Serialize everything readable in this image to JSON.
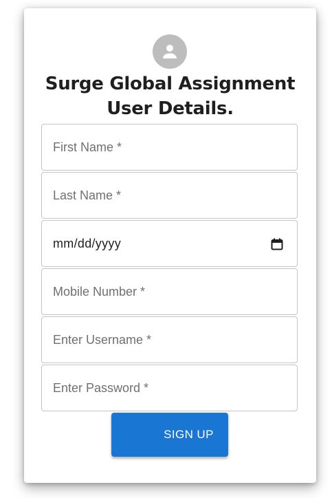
{
  "header": {
    "avatar_icon": "person-icon",
    "title_line1": "Surge Global Assignment",
    "title_line2": "User Details."
  },
  "form": {
    "first_name": {
      "placeholder": "First Name *",
      "value": ""
    },
    "last_name": {
      "placeholder": "Last Name *",
      "value": ""
    },
    "birth_date": {
      "display": "mm/dd/yyyy",
      "icon": "calendar-icon"
    },
    "mobile_number": {
      "placeholder": "Mobile Number *",
      "value": ""
    },
    "username": {
      "placeholder": "Enter Username *",
      "value": ""
    },
    "password": {
      "placeholder": "Enter Password *",
      "value": ""
    },
    "submit_label": "SIGN UP"
  },
  "colors": {
    "accent": "#1976d2",
    "avatar_bg": "#bdbdbd",
    "border": "#c4c4c4",
    "placeholder": "#707070"
  }
}
